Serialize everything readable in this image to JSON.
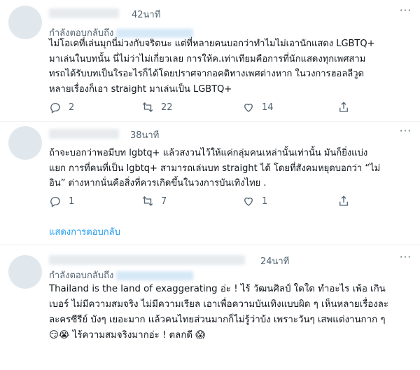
{
  "tweets": [
    {
      "time": "42นาที",
      "reply_label": "กำลังตอบกลับถึง",
      "lines": [
        "ไม่โอเคที่เล่นมุกนี่ม่วงกับจริตนะ แต่ที่หลายคนบอกว่าทำไมไม่เอานักแสดง LGBTQ+",
        "มาเล่นในบทนั้น นี่ไม่ว่าไม่เกี่ยวเลย การให้ค.เท่าเทียมคือการที่นักแสดงทุกเพศสาม",
        "ทรถได้รับบทเป็นใรอะไรก็ได้โดยปราศจากอคติทางเพศต่างหาก ในวงการฮอลลีวูด",
        "หลายเรื่องก็เอา straight มาเล่นเป็น LGBTQ+"
      ],
      "replies": "2",
      "retweets": "22",
      "likes": "14"
    },
    {
      "time": "38นาที",
      "lines": [
        "ถ้าจะบอกว่าพอมีบท lgbtq+ แล้วสงวนไว้ให้แค่กลุ่มคนเหล่านั้นเท่านั้น มันก็ยิ่งแบ่ง",
        "แยก การที่คนที่เป็น lgbtq+ สามารถเล่นบท straight ได้ โดยที่สังคมหยุดบอกว่า “ไม่",
        "อิน” ต่างหากนั่นคือสิ่งที่ควรเกิดขึ้นในวงการบันเทิงไทย ."
      ],
      "replies": "1",
      "retweets": "7",
      "likes": "1",
      "show_replies": "แสดงการตอบกลับ"
    },
    {
      "time": "24นาที",
      "reply_label": "กำลังตอบกลับถึง",
      "lines": [
        "Thailand is the land of exaggerating อ่ะ ! ไร้ วัฒนศิลป์ ใดใด ทำอะไร เพ้อ เกิน",
        "เบอร์ ไม่มีความสมจริง ไม่มีความเรียล เอาเพื่อความบันเทิงแบบผิด ๆ เห็นหลายเรื่องละ",
        "ละครซีรีย์ บังๆ เยอะมาก แล้วคนไทยส่วนมากก็ไม่รู้ว่าบ้ง เพราะวันๆ เสพแต่งานกาก ๆ",
        "😏😭 ไร้ความสมจริงมากอ่ะ ! ตลกดี 😱"
      ]
    }
  ],
  "icons": {
    "reply": "reply-icon",
    "retweet": "retweet-icon",
    "like": "like-icon",
    "share": "share-icon",
    "more": "more-icon"
  },
  "colors": {
    "text": "#0f1419",
    "muted": "#536471",
    "link": "#1d9bf0",
    "divider": "#eff3f4"
  }
}
